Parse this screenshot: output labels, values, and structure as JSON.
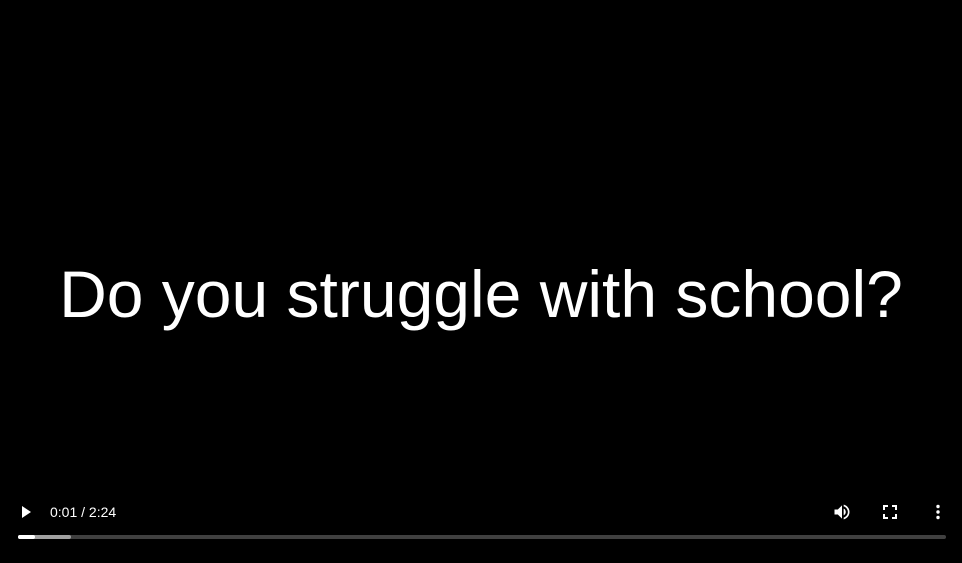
{
  "video": {
    "caption": "Do you struggle with school?",
    "current_time": "0:01",
    "separator": " / ",
    "duration": "2:24",
    "progress_played_fraction": 0.018,
    "progress_buffered_fraction": 0.057
  },
  "controls": {
    "play_icon": "play-icon",
    "volume_icon": "volume-icon",
    "fullscreen_icon": "fullscreen-icon",
    "more_icon": "more-vertical-icon"
  },
  "colors": {
    "background": "#000000",
    "text": "#ffffff",
    "progress_track": "rgba(255,255,255,0.25)",
    "progress_buffer": "rgba(255,255,255,0.5)",
    "progress_played": "#ffffff"
  }
}
